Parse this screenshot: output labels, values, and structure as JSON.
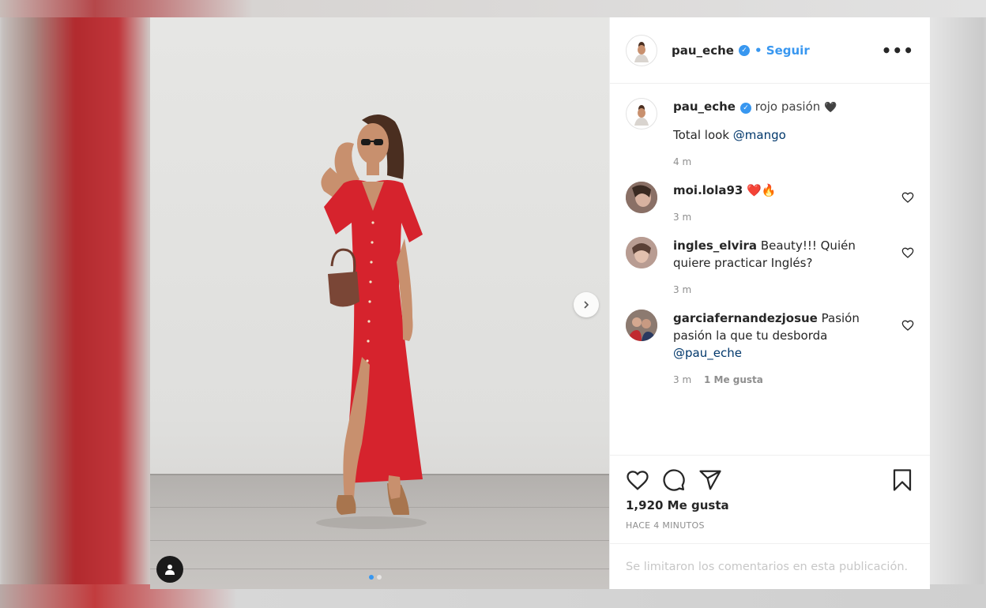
{
  "post": {
    "author": "pau_eche",
    "follow_label": "• Seguir",
    "more_label": "•••",
    "photo_dots": 2,
    "caption": {
      "username": "pau_eche",
      "text": "rojo pasión",
      "heart_emoji": "🖤",
      "line2_prefix": "Total look ",
      "line2_mention": "@mango",
      "time": "4 m"
    },
    "comments": [
      {
        "username": "moi.lola93",
        "text": "❤️🔥",
        "time": "3 m",
        "likes": ""
      },
      {
        "username": "ingles_elvira",
        "text": "Beauty!!! Quién quiere practicar Inglés?",
        "time": "3 m",
        "likes": ""
      },
      {
        "username": "garciafernandezjosue",
        "text": "Pasión pasión la que tu desborda ",
        "mention": "@pau_eche",
        "time": "3 m",
        "likes": "1 Me gusta"
      }
    ],
    "likes_count": "1,920 Me gusta",
    "posted_ago": "HACE 4 MINUTOS",
    "comments_disabled": "Se limitaron los comentarios en esta publicación."
  },
  "colors": {
    "accent": "#3897f0",
    "dress": "#d6232d",
    "text_primary": "#262626",
    "text_secondary": "#8e8e8e"
  },
  "icons": [
    "heart-icon",
    "comment-icon",
    "share-icon",
    "bookmark-icon",
    "chevron-right-icon",
    "user-tag-icon",
    "verified-icon",
    "more-icon"
  ]
}
